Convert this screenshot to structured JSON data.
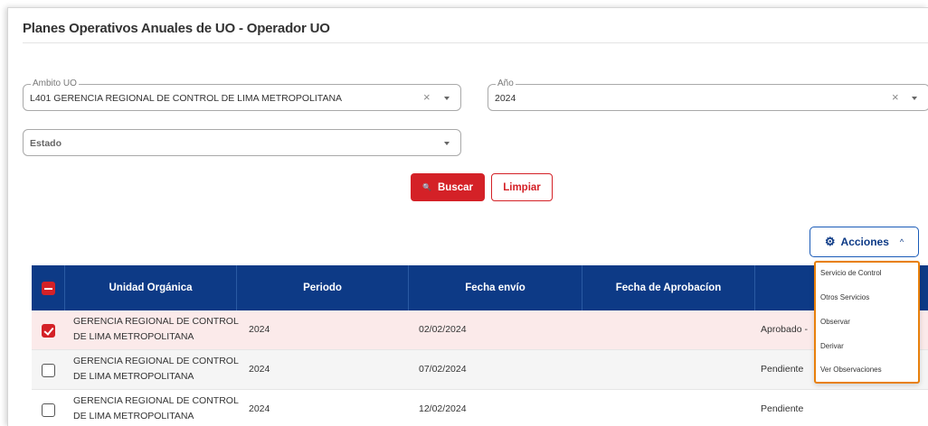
{
  "page": {
    "title": "Planes Operativos Anuales de UO - Operador UO"
  },
  "filters": {
    "ambito": {
      "label": "Ambito UO",
      "value": "L401 GERENCIA REGIONAL DE CONTROL DE LIMA METROPOLITANA",
      "clear": "×"
    },
    "anio": {
      "label": "Año",
      "value": "2024",
      "clear": "×"
    },
    "estado": {
      "placeholder": "Estado"
    }
  },
  "buttons": {
    "buscar": "Buscar",
    "limpiar": "Limpiar",
    "acciones": "Acciones"
  },
  "icons": {
    "search": "search-icon",
    "gear": "gear-icon",
    "chevron_up": "chevron-up-icon"
  },
  "table": {
    "headers": [
      "Unidad Orgánica",
      "Periodo",
      "Fecha envío",
      "Fecha de Aprobacíon"
    ],
    "rows": [
      {
        "uo": "GERENCIA REGIONAL DE CONTROL DE LIMA METROPOLITANA",
        "periodo": "2024",
        "fecha_envio": "02/02/2024",
        "fecha_aprobacion": "",
        "estado": "Aprobado -",
        "checked": true
      },
      {
        "uo": "GERENCIA REGIONAL DE CONTROL DE LIMA METROPOLITANA",
        "periodo": "2024",
        "fecha_envio": "07/02/2024",
        "fecha_aprobacion": "",
        "estado": "Pendiente",
        "checked": false
      },
      {
        "uo": "GERENCIA REGIONAL DE CONTROL DE LIMA METROPOLITANA",
        "periodo": "2024",
        "fecha_envio": "12/02/2024",
        "fecha_aprobacion": "",
        "estado": "Pendiente",
        "checked": false
      }
    ]
  },
  "acciones_menu": {
    "items": [
      "Servicio de Control",
      "Otros Servicios",
      "Observar",
      "Derivar",
      "Ver Observaciones"
    ]
  },
  "colors": {
    "primary_red": "#d42127",
    "header_blue": "#0d3a86",
    "selected_row": "#fbeaea",
    "menu_highlight": "#e8800c"
  }
}
